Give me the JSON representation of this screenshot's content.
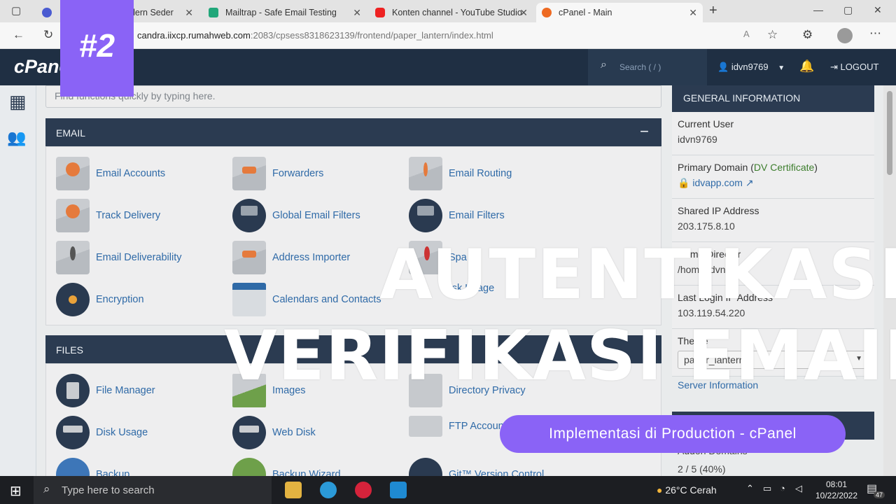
{
  "browser": {
    "tabs": [
      {
        "label": "odern Seder",
        "active": false
      },
      {
        "label": "Mailtrap - Safe Email Testing",
        "active": false
      },
      {
        "label": "Konten channel - YouTube Studio",
        "active": false
      },
      {
        "label": "cPanel - Main",
        "active": true
      }
    ],
    "url_main": "candra.iixcp.rumahweb.com",
    "url_rest": ":2083/cpsess8318623139/frontend/paper_lantern/index.html"
  },
  "cpanel": {
    "logo": "cPanel",
    "search_placeholder": "Search ( / )",
    "username": "idvn9769",
    "logout": "LOGOUT",
    "find_placeholder": "Find functions quickly by typing here.",
    "email_section": {
      "title": "EMAIL",
      "items": [
        "Email Accounts",
        "Forwarders",
        "Email Routing",
        "Track Delivery",
        "Global Email Filters",
        "Email Filters",
        "Email Deliverability",
        "Address Importer",
        "Spa",
        "Encryption",
        "Calendars and Contacts",
        "Disk Usage"
      ]
    },
    "files_section": {
      "title": "FILES",
      "items": [
        "File Manager",
        "Images",
        "Directory Privacy",
        "Disk Usage",
        "Web Disk",
        "FTP Accoun",
        "Backup",
        "Backup Wizard",
        "Git™ Version Control"
      ]
    },
    "general_info": {
      "title": "GENERAL INFORMATION",
      "current_user_label": "Current User",
      "current_user": "idvn9769",
      "primary_domain_label": "Primary Domain",
      "certificate": "DV Certificate",
      "primary_domain": "idvapp.com",
      "shared_ip_label": "Shared IP Address",
      "shared_ip": "203.175.8.10",
      "home_dir_label": "Home Director",
      "home_dir": "/home/idvn9",
      "last_login_label": "Last Login IP Address",
      "last_login": "103.119.54.220",
      "theme_label": "Theme",
      "theme_value": "paper_lantern",
      "server_info": "Server Information",
      "addon_label": "Addon Domains",
      "addon_value": "2 / 5   (40%)"
    }
  },
  "taskbar": {
    "search_placeholder": "Type here to search",
    "weather": "26°C  Cerah",
    "time": "08:01",
    "date": "10/22/2022",
    "notifications": "47"
  },
  "overlay": {
    "badge": "#2",
    "line1": "AUTENTIKASI",
    "line2": "VERIFIKASI EMAIL",
    "pill": "Implementasi di Production - cPanel"
  },
  "colors": {
    "accent_purple": "#8a63f6",
    "cpanel_navy": "#1f2f43",
    "link_blue": "#2f6aa7"
  }
}
